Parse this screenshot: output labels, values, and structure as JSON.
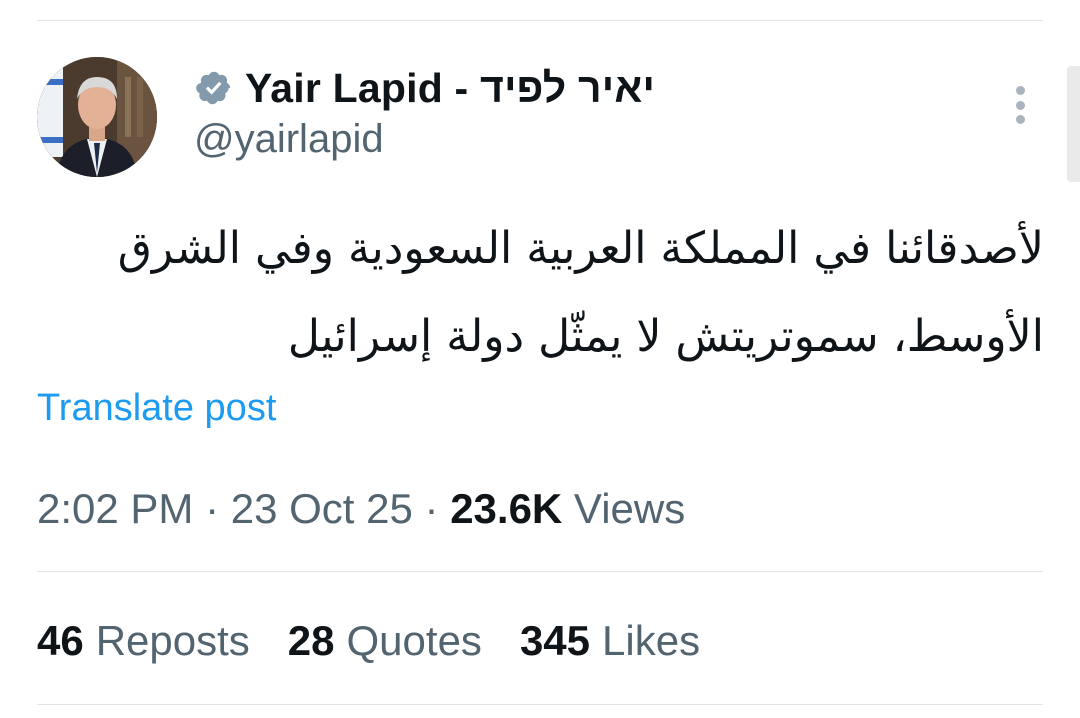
{
  "author": {
    "display_name": "Yair Lapid - יאיר לפיד",
    "handle": "@yairlapid",
    "verified": true,
    "avatar_icon": "profile-photo"
  },
  "tweet": {
    "line1": "لأصدقائنا في المملكة العربية السعودية وفي الشرق",
    "line2": "الأوسط، سموتريتش لا يمثّل دولة إسرائيل",
    "translate_label": "Translate post"
  },
  "meta": {
    "time": "2:02 PM",
    "sep1": " · ",
    "date": "23 Oct 25",
    "sep2": " · ",
    "views_count": "23.6K",
    "views_label": " Views"
  },
  "stats": {
    "reposts_count": "46",
    "reposts_label": "Reposts",
    "quotes_count": "28",
    "quotes_label": "Quotes",
    "likes_count": "345",
    "likes_label": "Likes"
  },
  "colors": {
    "text_primary": "#0f1419",
    "text_secondary": "#536471",
    "link": "#1d9bf0",
    "verified_badge": "#829aab",
    "divider": "#e6e6e6"
  },
  "icons": {
    "verified": "verified-badge-icon",
    "more": "more-vertical-icon"
  }
}
